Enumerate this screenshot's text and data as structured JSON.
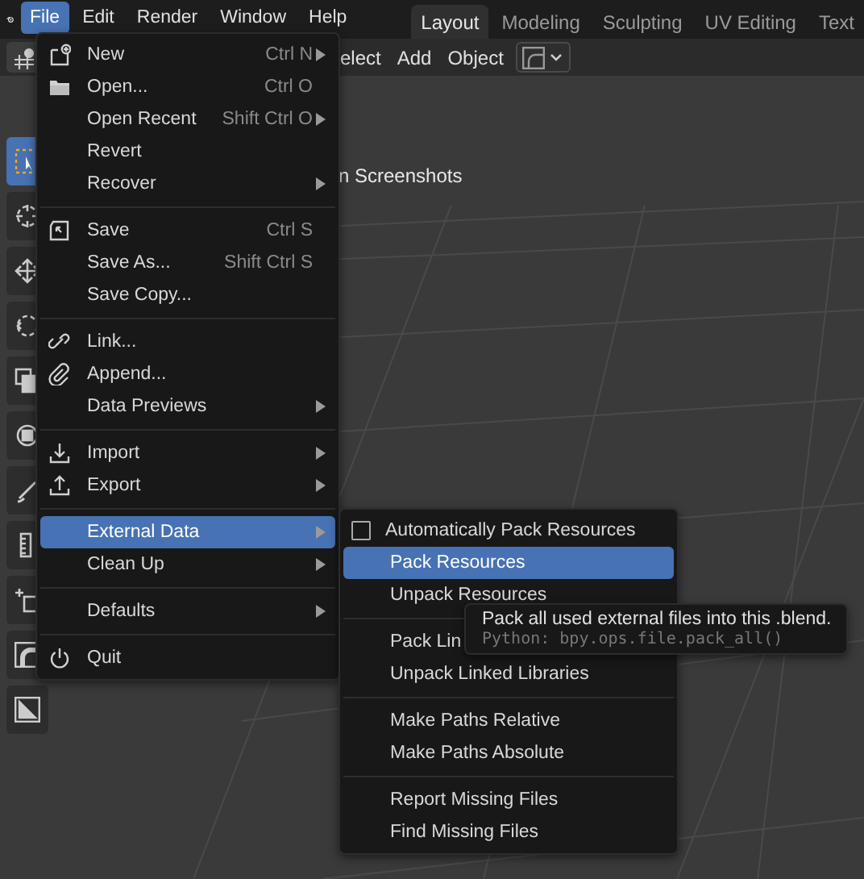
{
  "topbar": {
    "menus": [
      {
        "label": "File",
        "selected": true
      },
      {
        "label": "Edit",
        "selected": false
      },
      {
        "label": "Render",
        "selected": false
      },
      {
        "label": "Window",
        "selected": false
      },
      {
        "label": "Help",
        "selected": false
      }
    ],
    "workspace_tabs": [
      {
        "label": "Layout",
        "selected": true
      },
      {
        "label": "Modeling",
        "selected": false
      },
      {
        "label": "Sculpting",
        "selected": false
      },
      {
        "label": "UV Editing",
        "selected": false
      },
      {
        "label": "Text",
        "selected": false
      }
    ]
  },
  "header": {
    "menus": [
      "elect",
      "Add",
      "Object"
    ]
  },
  "viewport": {
    "info_text": "n Screenshots"
  },
  "toolbar": {
    "tools": [
      {
        "kind": "select",
        "selected": true
      },
      {
        "kind": "cursor",
        "selected": false
      },
      {
        "kind": "move",
        "selected": false
      },
      {
        "kind": "rotate",
        "selected": false
      },
      {
        "kind": "scale",
        "selected": false
      },
      {
        "kind": "transform",
        "selected": false
      },
      {
        "kind": "annotate",
        "selected": false
      },
      {
        "kind": "measure",
        "selected": false
      },
      {
        "kind": "add",
        "selected": false
      },
      {
        "kind": "curve",
        "selected": false
      },
      {
        "kind": "shear",
        "selected": false
      }
    ]
  },
  "file_menu": {
    "items": [
      {
        "kind": "new",
        "label": "New",
        "shortcut": "Ctrl N",
        "submenu": true,
        "selected": false
      },
      {
        "kind": "open",
        "label": "Open...",
        "shortcut": "Ctrl O",
        "submenu": false,
        "selected": false
      },
      {
        "kind": "plain",
        "label": "Open Recent",
        "shortcut": "Shift Ctrl O",
        "submenu": true,
        "selected": false
      },
      {
        "kind": "plain",
        "label": "Revert",
        "submenu": false,
        "selected": false
      },
      {
        "kind": "plain",
        "label": "Recover",
        "submenu": true,
        "selected": false
      },
      {
        "kind": "separator"
      },
      {
        "kind": "save",
        "label": "Save",
        "shortcut": "Ctrl S",
        "submenu": false,
        "selected": false
      },
      {
        "kind": "plain",
        "label": "Save As...",
        "shortcut": "Shift Ctrl S",
        "submenu": false,
        "selected": false
      },
      {
        "kind": "plain",
        "label": "Save Copy...",
        "submenu": false,
        "selected": false
      },
      {
        "kind": "separator"
      },
      {
        "kind": "link",
        "label": "Link...",
        "submenu": false,
        "selected": false
      },
      {
        "kind": "append",
        "label": "Append...",
        "submenu": false,
        "selected": false
      },
      {
        "kind": "plain",
        "label": "Data Previews",
        "submenu": true,
        "selected": false
      },
      {
        "kind": "separator"
      },
      {
        "kind": "import",
        "label": "Import",
        "submenu": true,
        "selected": false
      },
      {
        "kind": "export",
        "label": "Export",
        "submenu": true,
        "selected": false
      },
      {
        "kind": "separator"
      },
      {
        "kind": "plain",
        "label": "External Data",
        "submenu": true,
        "selected": true
      },
      {
        "kind": "plain",
        "label": "Clean Up",
        "submenu": true,
        "selected": false
      },
      {
        "kind": "separator"
      },
      {
        "kind": "plain",
        "label": "Defaults",
        "submenu": true,
        "selected": false
      },
      {
        "kind": "separator"
      },
      {
        "kind": "quit",
        "label": "Quit",
        "submenu": false,
        "selected": false
      }
    ]
  },
  "external_data_menu": {
    "items": [
      {
        "kind": "checkbox",
        "label": "Automatically Pack Resources",
        "checked": false,
        "selected": false
      },
      {
        "kind": "plain",
        "label": "Pack Resources",
        "selected": true
      },
      {
        "kind": "plain",
        "label": "Unpack Resources",
        "selected": false
      },
      {
        "kind": "separator"
      },
      {
        "kind": "plain",
        "label": "Pack Lin",
        "selected": false
      },
      {
        "kind": "plain",
        "label": "Unpack Linked Libraries",
        "selected": false
      },
      {
        "kind": "separator"
      },
      {
        "kind": "plain",
        "label": "Make Paths Relative",
        "selected": false
      },
      {
        "kind": "plain",
        "label": "Make Paths Absolute",
        "selected": false
      },
      {
        "kind": "separator"
      },
      {
        "kind": "plain",
        "label": "Report Missing Files",
        "selected": false
      },
      {
        "kind": "plain",
        "label": "Find Missing Files",
        "selected": false
      }
    ]
  },
  "tooltip": {
    "description": "Pack all used external files into this .blend.",
    "python": "Python: bpy.ops.file.pack_all()"
  }
}
